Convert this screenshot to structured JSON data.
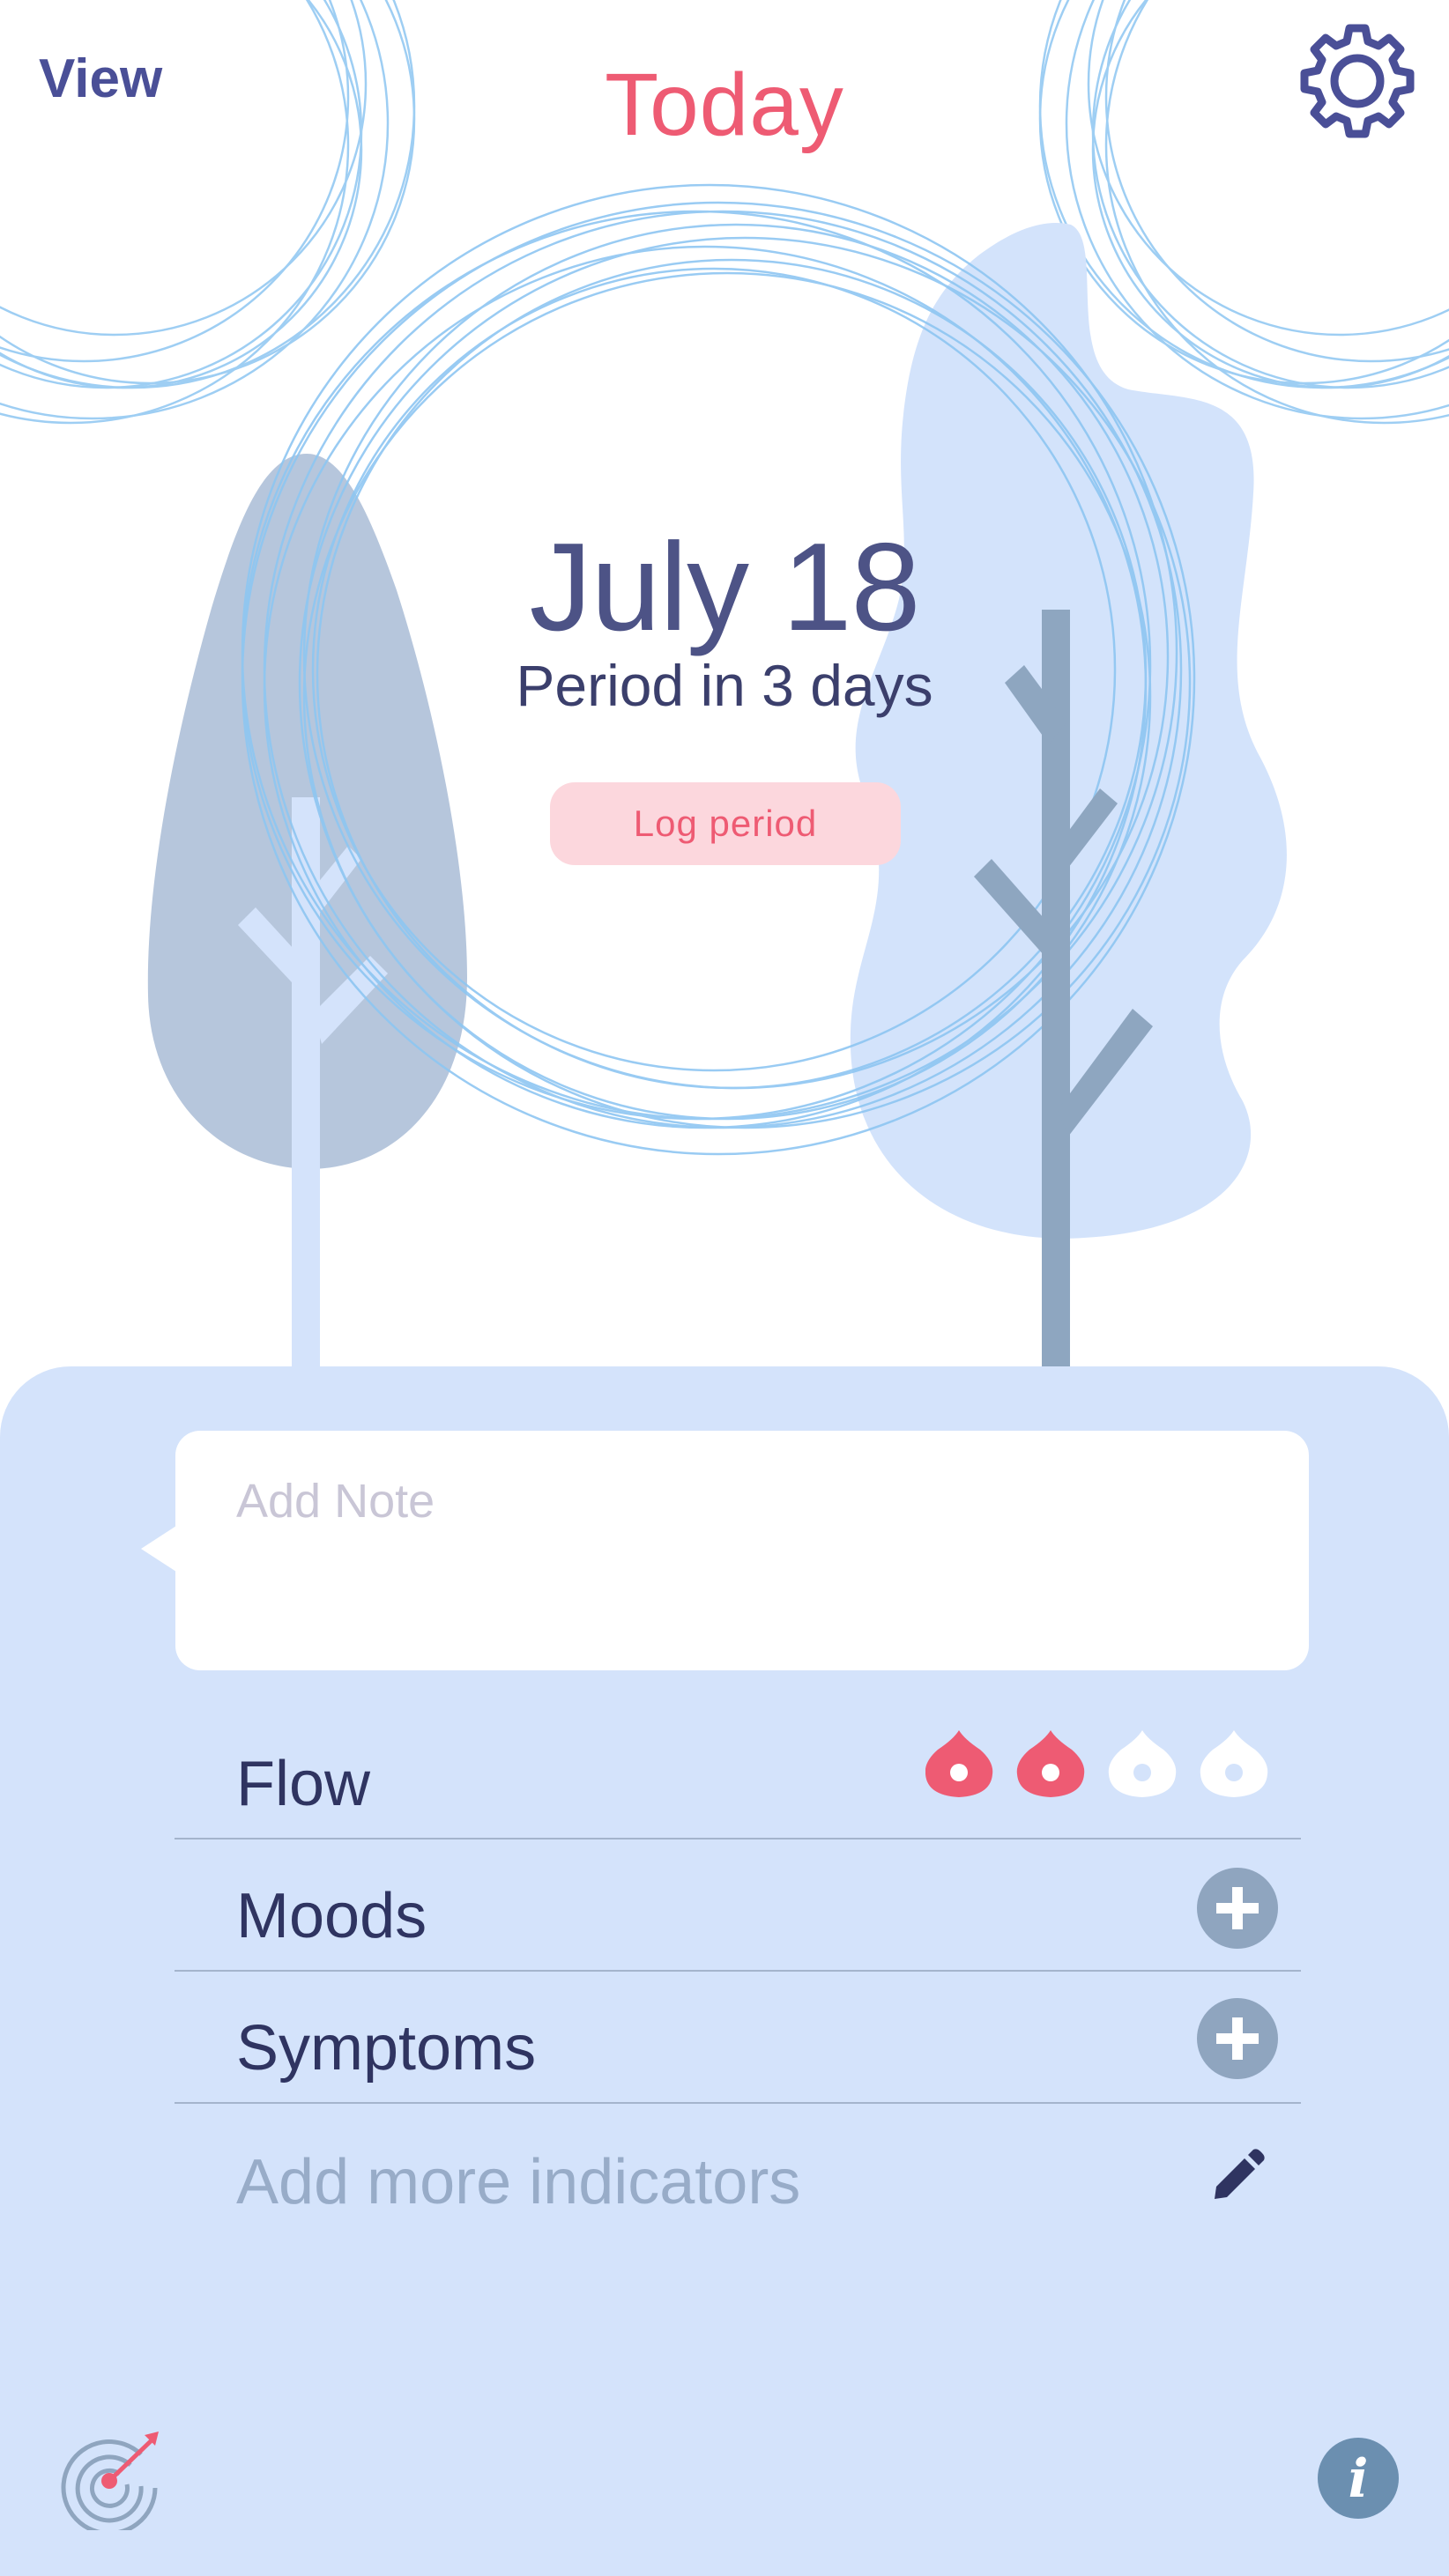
{
  "header": {
    "view_link": "View",
    "title": "Today",
    "settings_icon": "gear-icon"
  },
  "summary": {
    "date": "July 18",
    "prediction": "Period in 3 days",
    "log_button": "Log period"
  },
  "note": {
    "placeholder": "Add Note",
    "value": ""
  },
  "indicators": {
    "flow": {
      "label": "Flow",
      "level": 2,
      "max": 4,
      "icon": "drop-icon"
    },
    "moods": {
      "label": "Moods",
      "icon": "plus-circle-icon"
    },
    "symptoms": {
      "label": "Symptoms",
      "icon": "plus-circle-icon"
    },
    "add_more": {
      "label": "Add more indicators",
      "icon": "pencil-icon"
    }
  },
  "footer": {
    "left_icon": "target-icon",
    "right_icon": "info-icon"
  },
  "colors": {
    "accent": "#ee5b73",
    "primary": "#4a4f97",
    "panel": "#d4e3fb",
    "muted_icon": "#8fa5bf"
  }
}
